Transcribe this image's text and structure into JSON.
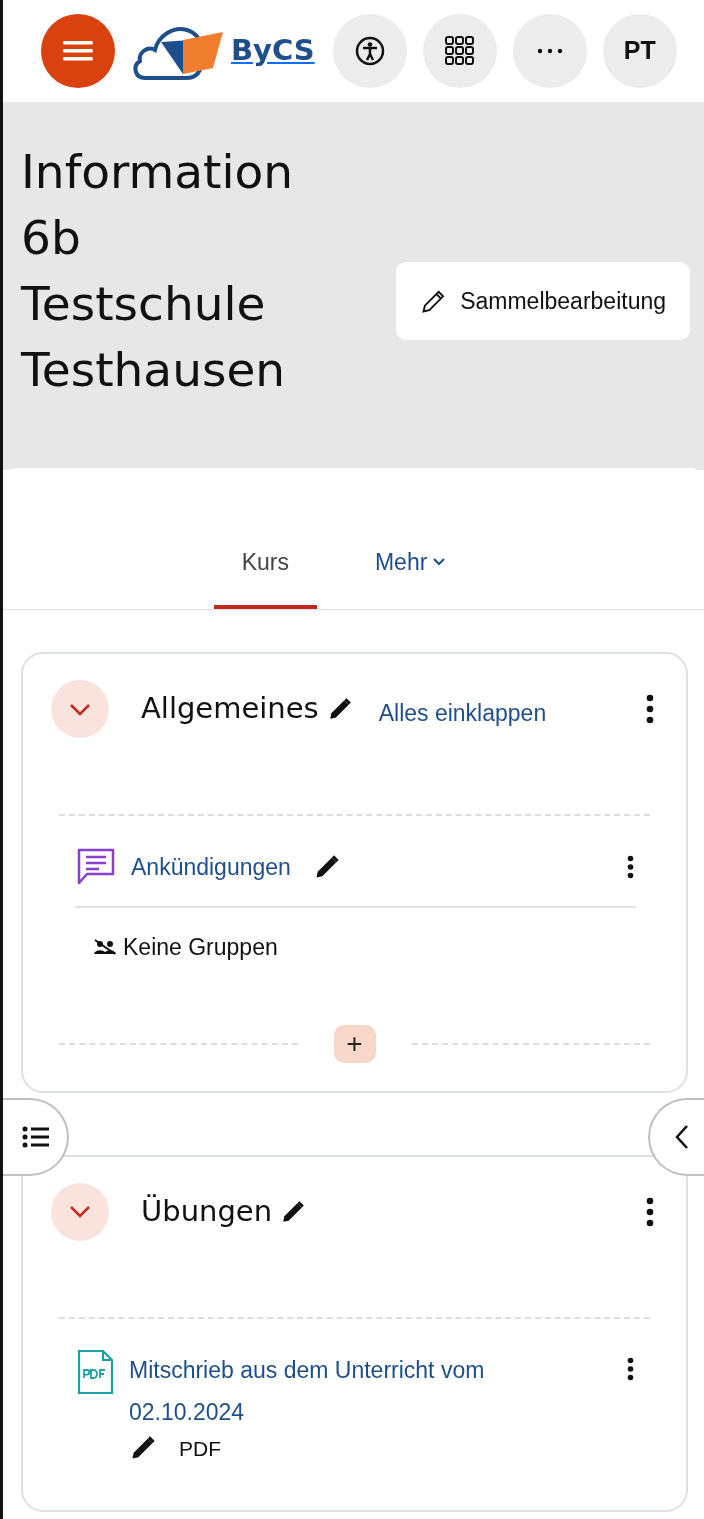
{
  "header": {
    "logo_text": "ByCS",
    "avatar_initials": "PT"
  },
  "page_title": "Information 6b Testschule Testhausen",
  "bulk_edit_button": "Sammelbearbeitung",
  "tabs": [
    {
      "label": "Kurs",
      "selected": true,
      "dropdown": false
    },
    {
      "label": "Mehr",
      "selected": false,
      "dropdown": true
    }
  ],
  "sections": [
    {
      "title": "Allgemeines",
      "expanded": true,
      "collapse_all_link": "Alles einklappen",
      "activities": [
        {
          "kind": "forum",
          "name": "Ankündigungen",
          "groups": "Keine Gruppen"
        }
      ],
      "add_button": "+"
    },
    {
      "title": "Übungen",
      "expanded": true,
      "activities": [
        {
          "kind": "pdf",
          "name": "Mitschrieb aus dem Unterricht vom 02.10.2024",
          "type_label": "PDF"
        }
      ]
    }
  ]
}
